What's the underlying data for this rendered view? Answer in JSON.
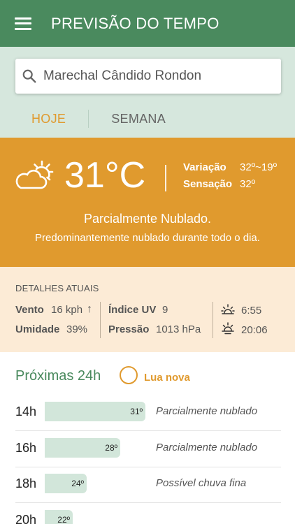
{
  "app": {
    "title": "PREVISÃO DO TEMPO"
  },
  "search": {
    "value": "Marechal Cândido Rondon"
  },
  "tabs": [
    {
      "label": "HOJE"
    },
    {
      "label": "SEMANA"
    }
  ],
  "current": {
    "temperature": "31°C",
    "range_label": "Variação",
    "range_value": "32º~19º",
    "feels_label": "Sensação",
    "feels_value": "32º",
    "condition": "Parcialmente Nublado.",
    "description": "Predominantemente nublado durante todo o dia.",
    "icon": "partly-cloudy-icon"
  },
  "details": {
    "title": "DETALHES ATUAIS",
    "wind_label": "Vento",
    "wind_value": "16 kph",
    "wind_arrow": "↑",
    "humidity_label": "Umidade",
    "humidity_value": "39%",
    "uv_label": "Índice UV",
    "uv_value": "9",
    "pressure_label": "Pressão",
    "pressure_value": "1013 hPa",
    "sunrise": "6:55",
    "sunset": "20:06"
  },
  "forecast": {
    "title": "Próximas 24h",
    "moon_label": "Lua nova",
    "hours": [
      {
        "time": "14h",
        "temp": "31º",
        "temp_value": 31,
        "condition": "Parcialmente nublado"
      },
      {
        "time": "16h",
        "temp": "28º",
        "temp_value": 28,
        "condition": "Parcialmente nublado"
      },
      {
        "time": "18h",
        "temp": "24º",
        "temp_value": 24,
        "condition": "Possível chuva fina"
      },
      {
        "time": "20h",
        "temp": "22º",
        "temp_value": 22,
        "condition": ""
      }
    ]
  },
  "colors": {
    "primary": "#4a8a5e",
    "accent": "#e09a2e",
    "mint": "#d6e7dd",
    "cream": "#fcebd6"
  }
}
